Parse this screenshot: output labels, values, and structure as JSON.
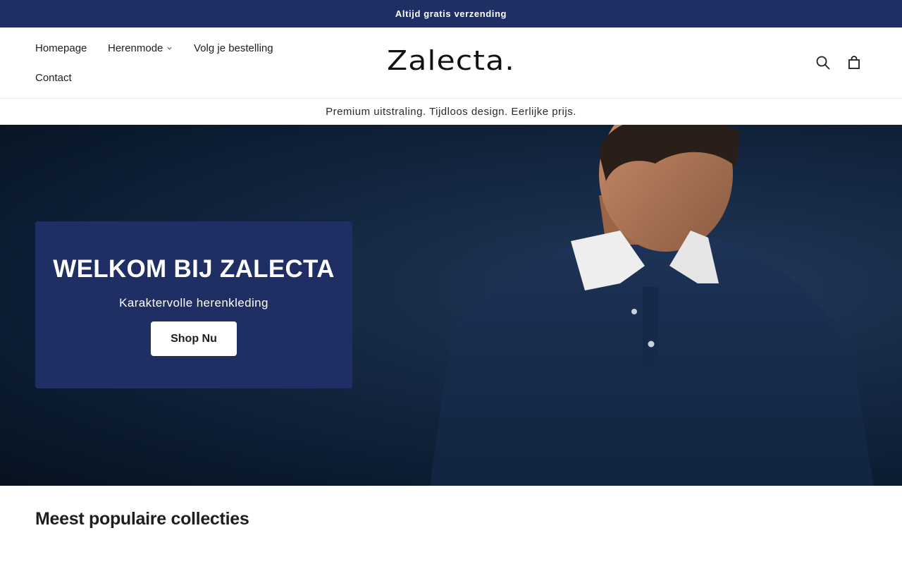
{
  "announcement": {
    "text": "Altijd gratis verzending"
  },
  "nav": {
    "items": [
      {
        "label": "Homepage"
      },
      {
        "label": "Herenmode"
      },
      {
        "label": "Volg je bestelling"
      },
      {
        "label": "Contact"
      }
    ]
  },
  "logo": {
    "text": "Zalecta."
  },
  "header_icons": {
    "search": "search-icon",
    "cart": "bag-icon"
  },
  "tagline": {
    "text": "Premium uitstraling. Tijdloos design. Eerlijke prijs."
  },
  "hero": {
    "title": "WELKOM BIJ ZALECTA",
    "subtitle": "Karaktervolle herenkleding",
    "button_label": "Shop Nu"
  },
  "section": {
    "title": "Meest populaire collecties"
  },
  "colors": {
    "brand_navy": "#1f2f63",
    "white": "#ffffff",
    "text": "#1e1e1e"
  }
}
